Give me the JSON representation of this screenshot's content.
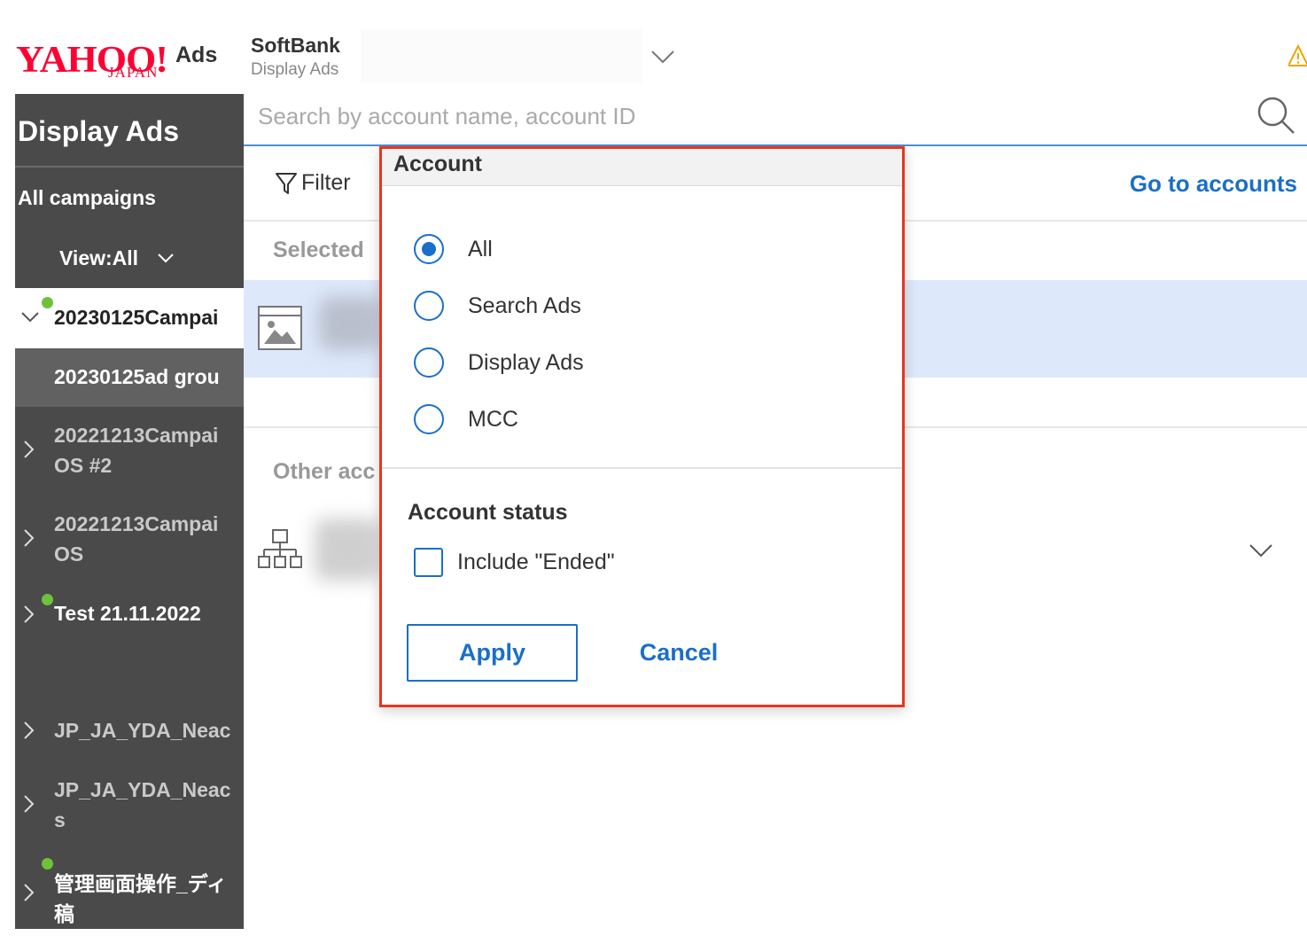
{
  "header": {
    "logo_main": "YAHOO!",
    "logo_sub": "JAPAN",
    "logo_product": "Ads",
    "account_name": "SoftBank",
    "account_type": "Display Ads"
  },
  "sidebar": {
    "title": "Display Ads",
    "all_campaigns": "All campaigns",
    "view_label": "View:All",
    "items": [
      {
        "label": "20230125Campai",
        "expanded": true,
        "active": true
      },
      {
        "label": "20230125ad grou",
        "selected_child": true
      },
      {
        "label": "20221213Campai",
        "label_line2": "OS #2"
      },
      {
        "label": "20221213Campai",
        "label_line2": "OS"
      },
      {
        "label": "Test 21.11.2022",
        "active": true
      },
      {
        "label": "JP_JA_YDA_Neac"
      },
      {
        "label": "JP_JA_YDA_Neac",
        "label_line2": "s"
      },
      {
        "label": "管理画面操作_ディ",
        "label_line2": "稿",
        "active": true
      }
    ]
  },
  "search": {
    "placeholder": "Search by account name, account ID"
  },
  "toolbar": {
    "filter_label": "Filter",
    "goto_accounts": "Go to accounts"
  },
  "list": {
    "selected_header": "Selected",
    "other_header": "Other acc"
  },
  "popup": {
    "title": "Account",
    "options": [
      "All",
      "Search Ads",
      "Display Ads",
      "MCC"
    ],
    "selected_option": "All",
    "status_title": "Account status",
    "include_ended_label": "Include \"Ended\"",
    "include_ended_checked": false,
    "apply_label": "Apply",
    "cancel_label": "Cancel"
  },
  "colors": {
    "accent": "#1a6fc9",
    "highlight_border": "#e8361e",
    "sidebar_bg": "#4a4a4a",
    "status_active": "#6dc23a",
    "selected_row": "#dde9fb",
    "brand": "#ff0033"
  }
}
